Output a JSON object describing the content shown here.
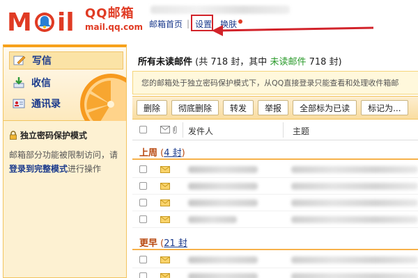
{
  "header": {
    "brand_cn": "QQ邮箱",
    "brand_url": "mail.qq.com",
    "nav": {
      "home": "邮箱首页",
      "separator": "|",
      "settings": "设置",
      "skin": "换肤"
    },
    "highlight_color": "#d2232a"
  },
  "sidebar": {
    "compose": "写信",
    "inbox": "收信",
    "contacts": "通讯录",
    "security_title": "独立密码保护模式",
    "security_desc": "邮箱部分功能被限制访问，请",
    "security_link": "登录到完整模式",
    "security_tail": "进行操作"
  },
  "main": {
    "title_bold": "所有未读邮件",
    "title_pre": " (共 718 封，其中 ",
    "title_green": "未读邮件",
    "title_post": " 718 封)",
    "notice": "您的邮箱处于独立密码保护模式下，从QQ直接登录只能查看和处理收件箱邮",
    "toolbar": [
      "删除",
      "彻底删除",
      "转发",
      "举报",
      "全部标为已读",
      "标记为..."
    ],
    "columns": {
      "sender": "发件人",
      "subject": "主题"
    },
    "groups": [
      {
        "label": "上周",
        "count_pre": " (",
        "count": "4 封",
        "count_post": ")"
      },
      {
        "label": "更早",
        "count_pre": " (",
        "count": "21 封",
        "count_post": ""
      }
    ]
  },
  "colors": {
    "brand_red": "#e03b24",
    "link_blue": "#1a3a8c",
    "unread_green": "#2a9a2a",
    "sidebar_orange": "#f7a11a"
  }
}
